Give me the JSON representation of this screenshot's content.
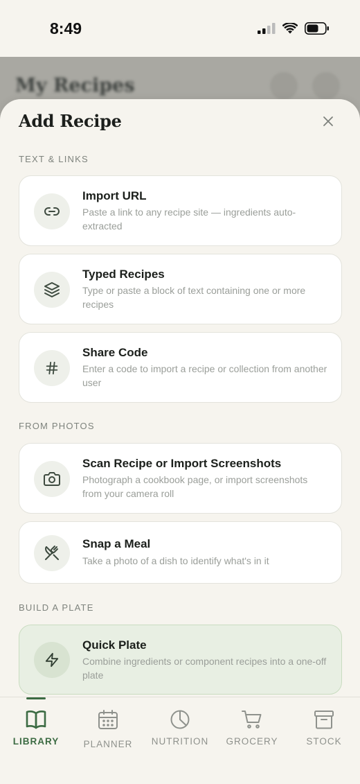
{
  "status_bar": {
    "time": "8:49"
  },
  "background": {
    "title": "My Recipes"
  },
  "sheet": {
    "title": "Add Recipe",
    "sections": [
      {
        "label": "TEXT & LINKS",
        "items": [
          {
            "title": "Import URL",
            "description": "Paste a link to any recipe site — ingredients auto-extracted",
            "icon": "link-icon"
          },
          {
            "title": "Typed Recipes",
            "description": "Type or paste a block of text containing one or more recipes",
            "icon": "layers-icon"
          },
          {
            "title": "Share Code",
            "description": "Enter a code to import a recipe or collection from another user",
            "icon": "hash-icon"
          }
        ]
      },
      {
        "label": "FROM PHOTOS",
        "items": [
          {
            "title": "Scan Recipe or Import Screenshots",
            "description": "Photograph a cookbook page, or import screenshots from your camera roll",
            "icon": "camera-icon"
          },
          {
            "title": "Snap a Meal",
            "description": "Take a photo of a dish to identify what's in it",
            "icon": "utensils-crossed-icon"
          }
        ]
      },
      {
        "label": "BUILD A PLATE",
        "items": [
          {
            "title": "Quick Plate",
            "description": "Combine ingredients or component recipes into a one-off plate",
            "icon": "lightning-icon"
          }
        ]
      }
    ]
  },
  "tabbar": {
    "tabs": [
      {
        "label": "LIBRARY",
        "icon": "book-icon",
        "active": true
      },
      {
        "label": "PLANNER",
        "icon": "calendar-icon",
        "active": false
      },
      {
        "label": "NUTRITION",
        "icon": "pie-chart-icon",
        "active": false
      },
      {
        "label": "GROCERY",
        "icon": "cart-icon",
        "active": false
      },
      {
        "label": "STOCK",
        "icon": "archive-icon",
        "active": false
      }
    ]
  },
  "colors": {
    "accent": "#3c6b43",
    "background": "#f6f4ee",
    "card": "#ffffff",
    "highlight_card": "#e8efe3"
  }
}
